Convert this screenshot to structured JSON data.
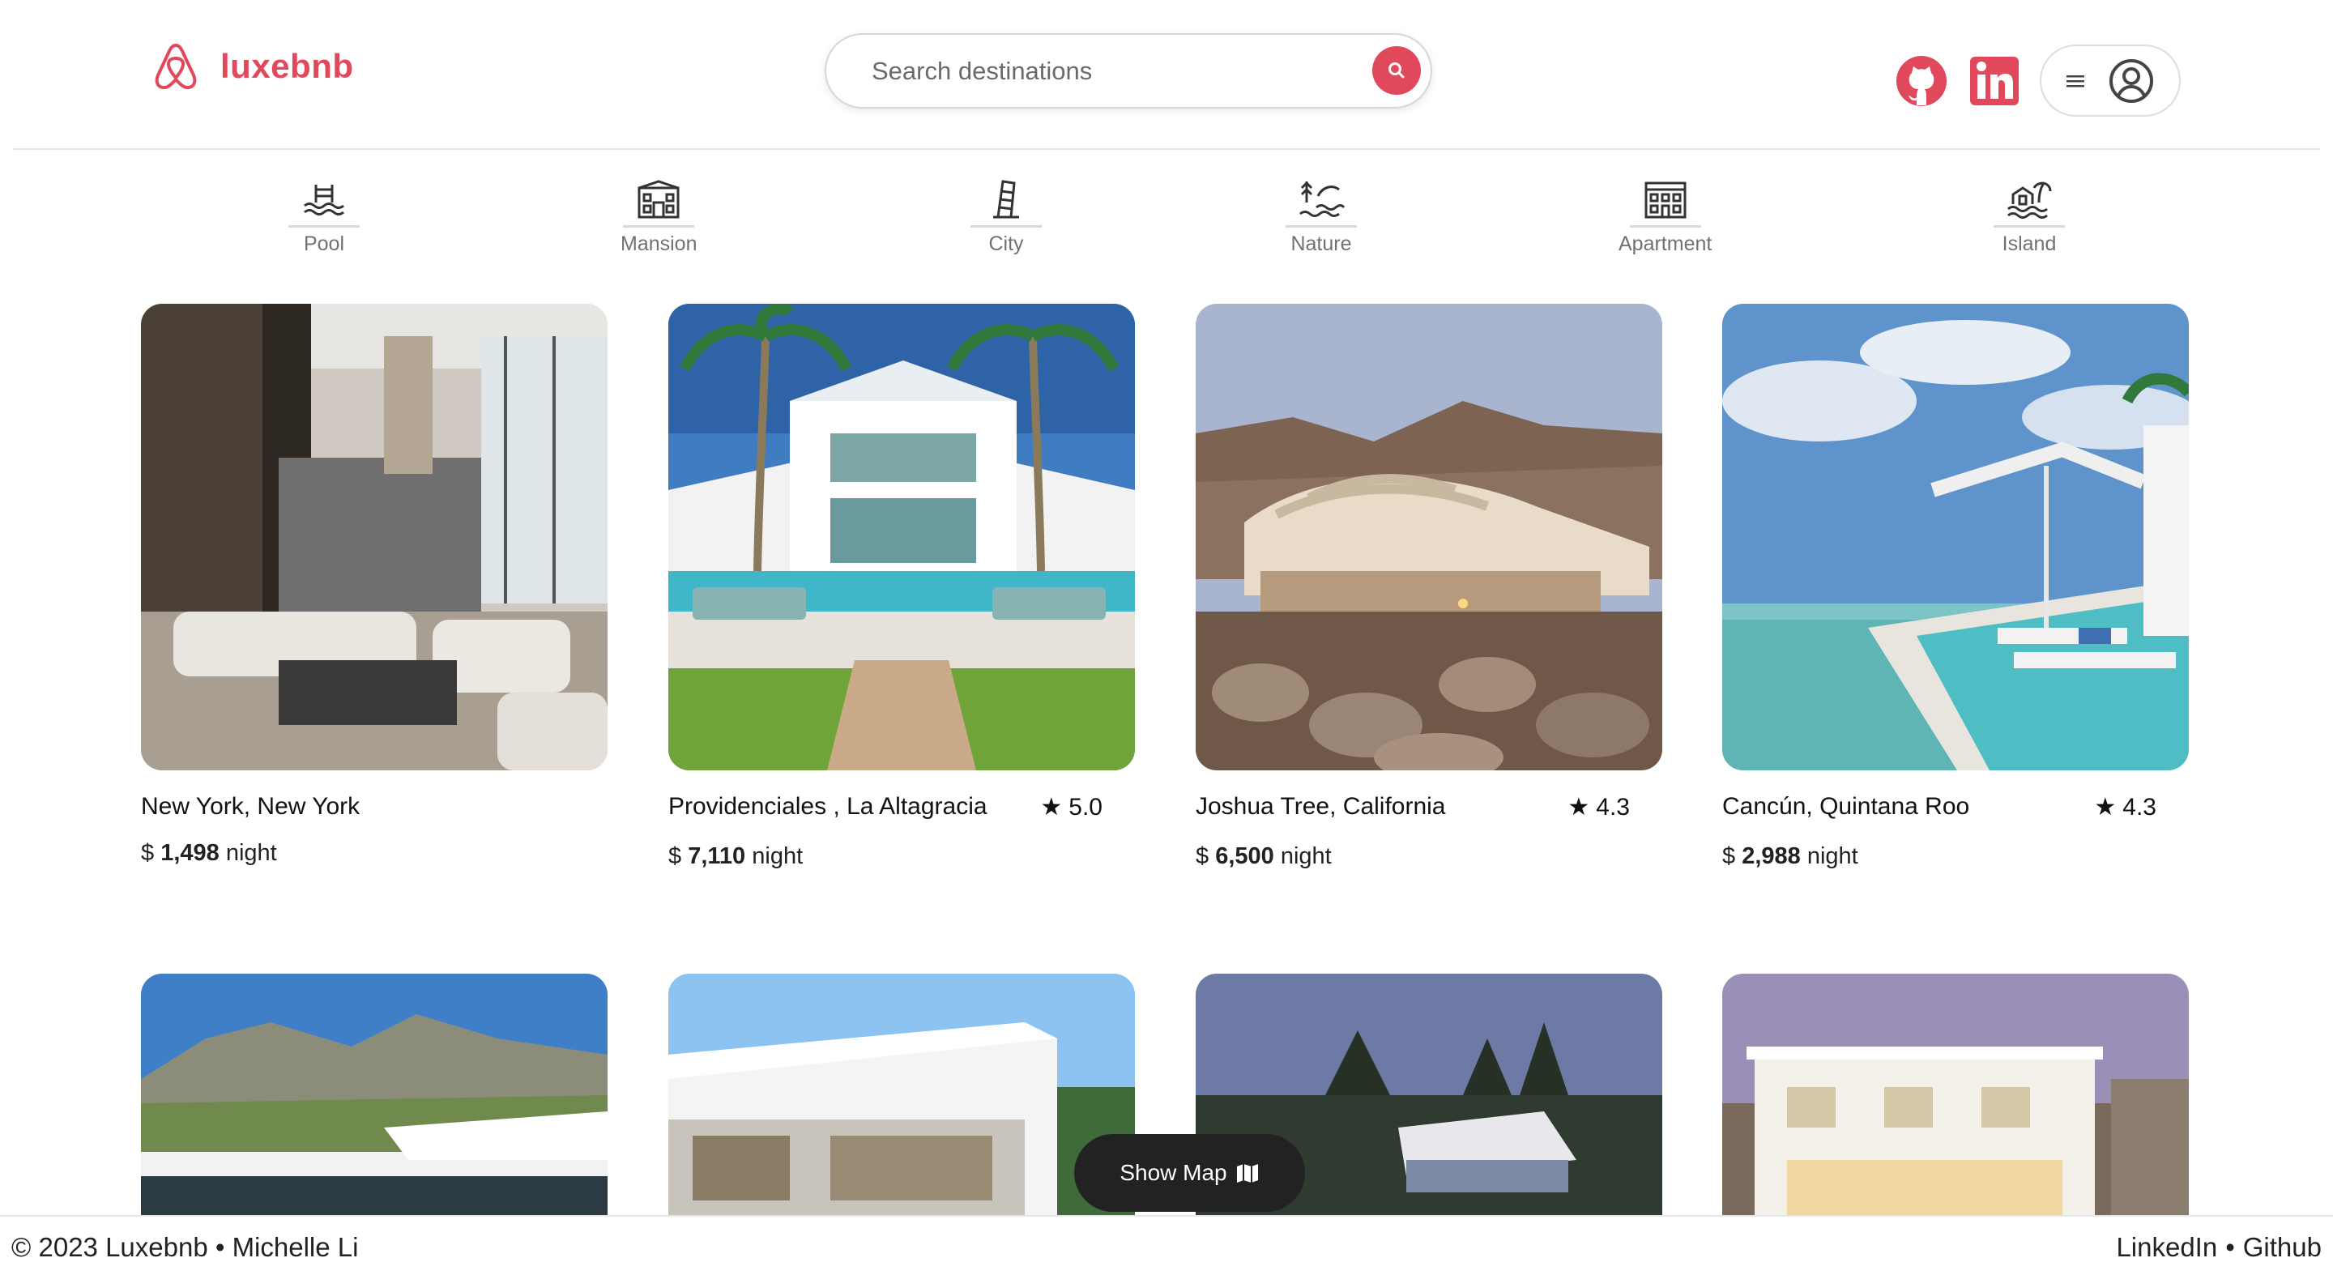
{
  "brand": {
    "name": "luxebnb",
    "color": "#e2485c",
    "logo_icon": "airbnb-logo-icon"
  },
  "search": {
    "placeholder": "Search destinations",
    "icon": "search-icon"
  },
  "header": {
    "github_icon": "github-icon",
    "linkedin_icon": "linkedin-icon",
    "menu_icon": "hamburger-icon",
    "avatar_icon": "user-circle-icon"
  },
  "categories": [
    {
      "label": "Pool",
      "icon": "pool-icon"
    },
    {
      "label": "Mansion",
      "icon": "mansion-icon"
    },
    {
      "label": "City",
      "icon": "city-icon"
    },
    {
      "label": "Nature",
      "icon": "nature-icon"
    },
    {
      "label": "Apartment",
      "icon": "apartment-icon"
    },
    {
      "label": "Island",
      "icon": "island-icon"
    }
  ],
  "listings": [
    {
      "title": "New York, New York",
      "rating": "",
      "currency": "$",
      "price": "1,498",
      "unit": "night"
    },
    {
      "title": "Providenciales , La Altagracia",
      "rating": "5.0",
      "currency": "$",
      "price": "7,110",
      "unit": "night"
    },
    {
      "title": "Joshua Tree, California",
      "rating": "4.3",
      "currency": "$",
      "price": "6,500",
      "unit": "night"
    },
    {
      "title": "Cancún, Quintana Roo",
      "rating": "4.3",
      "currency": "$",
      "price": "2,988",
      "unit": "night"
    }
  ],
  "show_map": {
    "label": "Show Map",
    "icon": "map-icon"
  },
  "footer": {
    "copyright": "© 2023 Luxebnb • Michelle Li",
    "linkedin": "LinkedIn",
    "separator": "•",
    "github": "Github"
  }
}
